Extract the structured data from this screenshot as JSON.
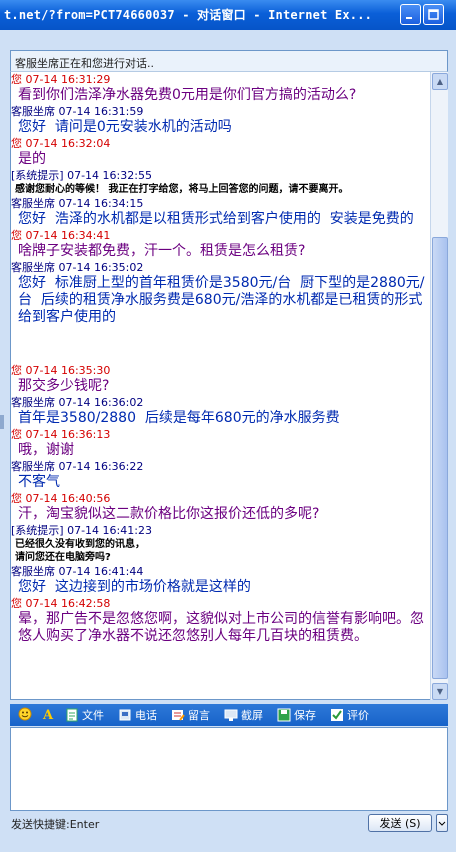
{
  "window": {
    "title": "t.net/?from=PCT74660037 - 对话窗口 - Internet Ex..."
  },
  "status": "客服坐席正在和您进行对话..",
  "messages": [
    {
      "role": "me",
      "header": "您 07-14 16:31:29",
      "text": "看到你们浩泽净水器免费0元用是你们官方搞的活动么?"
    },
    {
      "role": "agent",
      "header": "客服坐席 07-14 16:31:59",
      "text": "您好  请问是0元安装水机的活动吗"
    },
    {
      "role": "me",
      "header": "您 07-14 16:32:04",
      "text": "是的"
    },
    {
      "role": "sys",
      "header": "[系统提示] 07-14 16:32:55",
      "text": "感谢您耐心的等候！ 我正在打字给您，将马上回答您的问题，请不要离开。"
    },
    {
      "role": "agent",
      "header": "客服坐席 07-14 16:34:15",
      "text": "您好  浩泽的水机都是以租赁形式给到客户使用的  安装是免费的"
    },
    {
      "role": "me",
      "header": "您 07-14 16:34:41",
      "text": "啥牌子安装都免费，汗一个。租赁是怎么租赁?"
    },
    {
      "role": "agent",
      "header": "客服坐席 07-14 16:35:02",
      "text": "您好  标准厨上型的首年租赁价是3580元/台  厨下型的是2880元/台  后续的租赁净水服务费是680元/浩泽的水机都是已租赁的形式给到客户使用的",
      "extra_space": true
    },
    {
      "role": "me",
      "header": "您 07-14 16:35:30",
      "text": "那交多少钱呢?"
    },
    {
      "role": "agent",
      "header": "客服坐席 07-14 16:36:02",
      "text": "首年是3580/2880  后续是每年680元的净水服务费"
    },
    {
      "role": "me",
      "header": "您 07-14 16:36:13",
      "text": "哦，谢谢"
    },
    {
      "role": "agent",
      "header": "客服坐席 07-14 16:36:22",
      "text": "不客气"
    },
    {
      "role": "me",
      "header": "您 07-14 16:40:56",
      "text": "汗，淘宝貌似这二款价格比你这报价还低的多呢?"
    },
    {
      "role": "sys",
      "header": "[系统提示] 07-14 16:41:23",
      "text": "已经很久没有收到您的讯息，\n请问您还在电脑旁吗?"
    },
    {
      "role": "agent",
      "header": "客服坐席 07-14 16:41:44",
      "text": "您好  这边接到的市场价格就是这样的"
    },
    {
      "role": "me",
      "header": "您 07-14 16:42:58",
      "text": "晕，那广告不是忽悠您啊，这貌似对上市公司的信誉有影响吧。忽悠人购买了净水器不说还忽悠别人每年几百块的租赁费。"
    }
  ],
  "toolbar": {
    "file": "文件",
    "phone": "电话",
    "message": "留言",
    "screenshot": "截屏",
    "save": "保存",
    "rate": "评价"
  },
  "footer": {
    "hint": "发送快捷键:Enter",
    "send": "发送 (S)"
  },
  "colors": {
    "title_bar": "#0a5fd8",
    "me_header": "#d40000",
    "agent_header": "#000080",
    "agent_text": "#002ab0",
    "me_text": "#6b0080"
  }
}
